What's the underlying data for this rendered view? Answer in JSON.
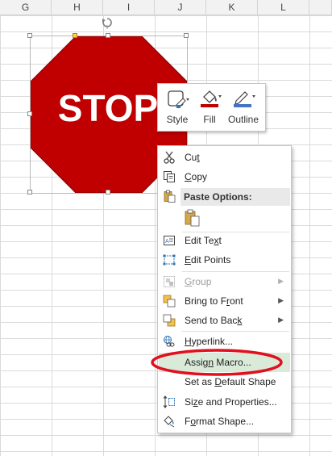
{
  "columns": [
    "G",
    "H",
    "I",
    "J",
    "K",
    "L"
  ],
  "shape": {
    "text": "STOP",
    "fill": "#C00000",
    "stroke": "#7f0000"
  },
  "mini_toolbar": {
    "style_label": "Style",
    "fill_label": "Fill",
    "outline_label": "Outline",
    "fill_color": "#C00000",
    "outline_color": "#4472C4"
  },
  "context_menu": {
    "cut": {
      "before": "Cu",
      "key": "t",
      "after": ""
    },
    "copy": {
      "before": "",
      "key": "C",
      "after": "opy"
    },
    "paste_options_label": "Paste Options:",
    "edit_text": {
      "before": "Edit Te",
      "key": "x",
      "after": "t"
    },
    "edit_points": {
      "before": "",
      "key": "E",
      "after": "dit Points"
    },
    "group": {
      "before": "",
      "key": "G",
      "after": "roup"
    },
    "bring_to_front": {
      "before": "Bring to F",
      "key": "r",
      "after": "ont"
    },
    "send_to_back": {
      "before": "Send to Bac",
      "key": "k",
      "after": ""
    },
    "hyperlink": {
      "before": "",
      "key": "H",
      "after": "yperlink..."
    },
    "assign_macro": {
      "before": "Assig",
      "key": "n",
      "after": " Macro..."
    },
    "set_default": {
      "before": "Set as ",
      "key": "D",
      "after": "efault Shape"
    },
    "size_props": {
      "before": "Si",
      "key": "z",
      "after": "e and Properties..."
    },
    "format_shape": {
      "before": "F",
      "key": "o",
      "after": "rmat Shape..."
    }
  },
  "colors": {
    "highlight": "#D9EAD8",
    "annotation": "#E0101E"
  }
}
